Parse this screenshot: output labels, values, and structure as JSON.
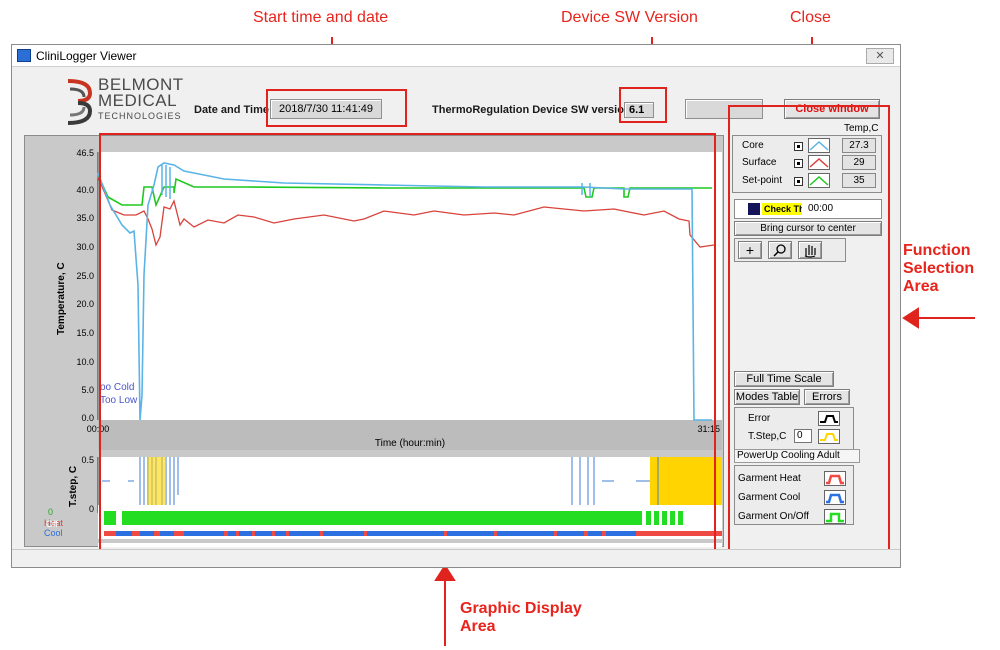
{
  "callouts": {
    "start_time": "Start time and date",
    "sw_version": "Device SW Version",
    "close": "Close",
    "function_area": "Function Selection Area",
    "graphic_area": "Graphic Display Area"
  },
  "window": {
    "title": "CliniLogger Viewer",
    "close_glyph": "✕"
  },
  "logo": {
    "line1": "BELMONT",
    "line2": "MEDICAL",
    "line3": "TECHNOLOGIES"
  },
  "header": {
    "date_label": "Date and Time",
    "date_value": "2018/7/30 11:41:49",
    "sw_label": "ThermoRegulation Device SW version",
    "sw_value": "6.1",
    "close_button": "Close window"
  },
  "main_chart": {
    "ylabel": "Temperature, C",
    "xlabel": "Time (hour:min)",
    "x_start": "00:00",
    "x_end": "31:15",
    "y_ticks": [
      "46.5",
      "40.0",
      "35.0",
      "30.0",
      "25.0",
      "20.0",
      "15.0",
      "10.0",
      "5.0",
      "0.0"
    ],
    "annotations": [
      "oo Cold",
      "Too Low"
    ]
  },
  "tstep_chart": {
    "ylabel": "T.step, C",
    "y_ticks": [
      "0.5",
      "0"
    ]
  },
  "mode_chart": {
    "labels": [
      "Heat",
      "Cool",
      "0",
      "Off"
    ]
  },
  "legend": {
    "header": "Temp,C",
    "rows": [
      {
        "label": "Core",
        "value": "27.3"
      },
      {
        "label": "Surface",
        "value": "29"
      },
      {
        "label": "Set-point",
        "value": "35"
      }
    ]
  },
  "cursor": {
    "status": "Check Th",
    "time": "00:00",
    "center_button": "Bring cursor to center"
  },
  "tools": {
    "crosshair": "+",
    "zoom": "🔍",
    "pan": "✋"
  },
  "buttons": {
    "full_time_scale": "Full Time Scale",
    "modes_table": "Modes Table",
    "errors": "Errors"
  },
  "error_panel": {
    "error_label": "Error",
    "tstep_label": "T.Step,C",
    "tstep_value": "0",
    "mode_text": "PowerUp Cooling Adult"
  },
  "garment_panel": {
    "heat": "Garment Heat",
    "cool": "Garment Cool",
    "onoff": "Garment On/Off"
  },
  "colors": {
    "callout_red": "#e8241c",
    "core_line": "#5ab4e6",
    "surface_line": "#d9423a",
    "setpoint_line": "#1ec91e",
    "heat_band": "#ef4a43",
    "cool_band": "#2c6fe0",
    "on_band": "#22dd22",
    "error_yellow": "#ffd400"
  }
}
